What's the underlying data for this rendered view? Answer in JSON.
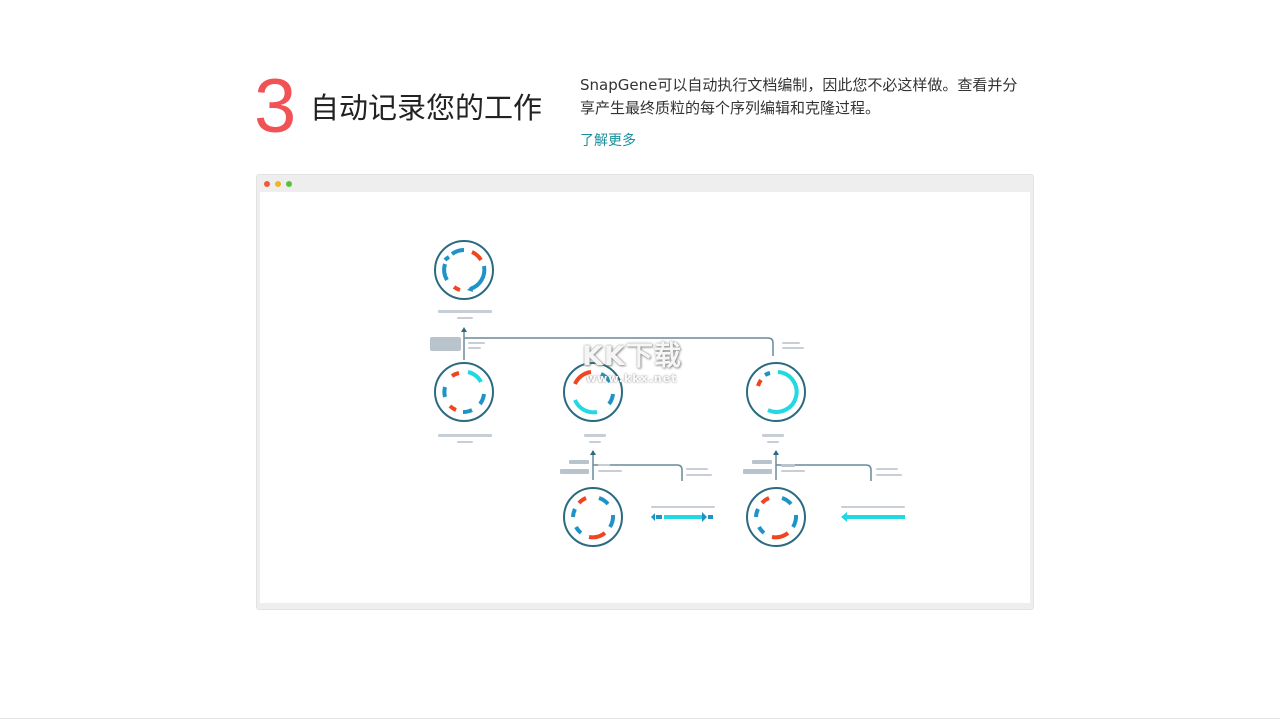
{
  "feature": {
    "number": "3",
    "title": "自动记录您的工作",
    "description": "SnapGene可以自动执行文档编制，因此您不必这样做。查看并分享产生最终质粒的每个序列编辑和克隆过程。",
    "learn_more": "了解更多"
  },
  "watermark": {
    "title": "KK下载",
    "url": "www.kkx.net"
  },
  "colors": {
    "number": "#f05256",
    "link": "#1a8f9e",
    "plasmid_ring": "#2a6b80",
    "arrow_blue": "#1e93c8",
    "arrow_red": "#f0451e",
    "arrow_cyan": "#20d9e3",
    "line_gray": "#b9c3cc"
  },
  "window": {
    "icons": [
      "close-dot",
      "minimize-dot",
      "maximize-dot"
    ]
  }
}
